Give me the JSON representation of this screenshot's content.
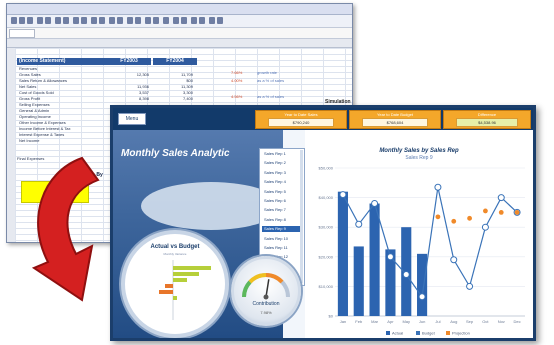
{
  "spreadsheet": {
    "headers": [
      "(Income Statement)",
      "FY2003",
      "FY2004"
    ],
    "rows": [
      {
        "label": "Revenues",
        "v1": "",
        "v2": ""
      },
      {
        "label": "Gross Sales",
        "v1": "12,305",
        "v2": "11,709"
      },
      {
        "label": "Sales Return & Allowances",
        "v1": "",
        "v2": "$00"
      },
      {
        "label": "Net Sales",
        "v1": "11,936",
        "v2": "11,309"
      },
      {
        "label": "Cost of Goods Sold",
        "v1": "3,537",
        "v2": "3,300"
      },
      {
        "label": "Gross Profit",
        "v1": "8,398",
        "v2": "7,400"
      },
      {
        "label": "Selling Expenses",
        "v1": "",
        "v2": ""
      },
      {
        "label": "General & Admin",
        "v1": "",
        "v2": ""
      },
      {
        "label": "Operating Income",
        "v1": "",
        "v2": ""
      },
      {
        "label": "Other Income & Expenses",
        "v1": "",
        "v2": ""
      },
      {
        "label": "Income Before Interest & Tax",
        "v1": "",
        "v2": ""
      },
      {
        "label": "Interest Expense & Taxes",
        "v1": "",
        "v2": ""
      },
      {
        "label": "Net Income",
        "v1": "",
        "v2": ""
      }
    ],
    "pcts": [
      "7.66%",
      "4.00%",
      "4.56%"
    ],
    "notes": [
      "growth rate",
      "as a % of sales",
      "as a % of sales"
    ],
    "simulation_label": "Simulation",
    "total_label": "Total Sales By",
    "final_expenses": "Final Expenses"
  },
  "dashboard": {
    "menu_label": "Menu",
    "title": "Monthly Sales Analytic",
    "kpis": [
      {
        "label": "Year to Date Sales",
        "value": "$790,240"
      },
      {
        "label": "Year to Date Budget",
        "value": "$768,604"
      },
      {
        "label": "Difference",
        "value": "$4,538.96"
      }
    ],
    "reps": [
      "Sales Rep 1",
      "Sales Rep 2",
      "Sales Rep 3",
      "Sales Rep 4",
      "Sales Rep 5",
      "Sales Rep 6",
      "Sales Rep 7",
      "Sales Rep 8",
      "Sales Rep 9",
      "Sales Rep 10",
      "Sales Rep 11",
      "Sales Rep 12",
      "Sales Rep 13",
      "Sales Rep 14"
    ],
    "selected_rep_index": 8,
    "actual_vs_budget": {
      "title": "Actual vs Budget",
      "subtitle": "Monthly Variance"
    },
    "gauge": {
      "label": "Contribution",
      "value": "7.98%",
      "level": 0.55
    }
  },
  "chart_data": [
    {
      "type": "bar",
      "title": "Monthly Sales by Sales Rep",
      "subtitle": "Sales Rep 9",
      "categories": [
        "Jan",
        "Feb",
        "Mar",
        "Apr",
        "May",
        "Jun",
        "Jul",
        "Aug",
        "Sep",
        "Oct",
        "Nov",
        "Dec"
      ],
      "y_ticks": [
        "$0",
        "$10,000",
        "$20,000",
        "$30,000",
        "$40,000",
        "$50,000"
      ],
      "ylim": [
        0,
        50000
      ],
      "series": [
        {
          "name": "Actual",
          "kind": "bar",
          "values": [
            42000,
            23500,
            38000,
            22500,
            30000,
            21000,
            null,
            null,
            null,
            null,
            null,
            null
          ]
        },
        {
          "name": "Budget",
          "kind": "line",
          "values": [
            41000,
            31000,
            38000,
            20000,
            14000,
            6500,
            43500,
            19000,
            10000,
            30000,
            40000,
            35000
          ]
        },
        {
          "name": "Projection",
          "kind": "dots",
          "values": [
            null,
            null,
            null,
            null,
            null,
            null,
            33500,
            32000,
            33000,
            35500,
            35000,
            35000
          ]
        }
      ],
      "legend": [
        "Actual",
        "Budget",
        "Projection"
      ]
    }
  ],
  "colors": {
    "bar": "#2c64b0",
    "line": "#3a73b8",
    "projection": "#f08a2a",
    "kpi": "#f4a72a",
    "arrow": "#d42020"
  }
}
